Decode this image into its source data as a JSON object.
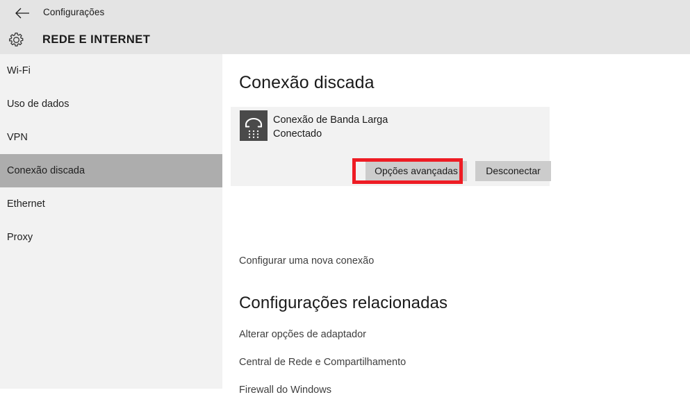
{
  "header": {
    "back_icon": "back-arrow-icon",
    "app_title": "Configurações",
    "gear_icon": "gear-icon",
    "category_title": "REDE E INTERNET",
    "background_color": "#e4e4e4"
  },
  "sidebar": {
    "background_color": "#f2f2f2",
    "selected_color": "#adadad",
    "items": [
      {
        "label": "Wi-Fi",
        "selected": false
      },
      {
        "label": "Uso de dados",
        "selected": false
      },
      {
        "label": "VPN",
        "selected": false
      },
      {
        "label": "Conexão discada",
        "selected": true
      },
      {
        "label": "Ethernet",
        "selected": false
      },
      {
        "label": "Proxy",
        "selected": false
      }
    ]
  },
  "main": {
    "page_heading": "Conexão discada",
    "connection_card": {
      "icon": "dialup-modem-icon",
      "icon_color": "#4a4a4a",
      "name": "Conexão de Banda Larga",
      "status": "Conectado",
      "background_color": "#f2f2f2",
      "buttons": [
        {
          "label": "Opções avançadas",
          "highlighted": true
        },
        {
          "label": "Desconectar",
          "highlighted": false
        }
      ],
      "button_color": "#cccccc"
    },
    "new_connection_link": "Configurar uma nova conexão",
    "related_heading": "Configurações relacionadas",
    "related_links": [
      "Alterar opções de adaptador",
      "Central de Rede e Compartilhamento",
      "Firewall do Windows"
    ]
  },
  "annotation": {
    "highlight_color": "#ee1c24",
    "target": "Opções avançadas"
  }
}
